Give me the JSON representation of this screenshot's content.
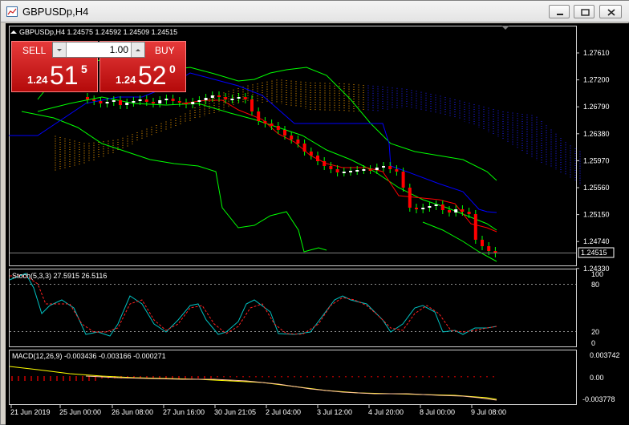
{
  "window": {
    "title": "GBPUSDp,H4"
  },
  "chart_header": "GBPUSDp,H4  1.24575 1.24592 1.24509 1.24515",
  "trade_panel": {
    "sell_label": "SELL",
    "buy_label": "BUY",
    "volume": "1.00",
    "sell_prefix": "1.24",
    "sell_big": "51",
    "sell_sup": "5",
    "buy_prefix": "1.24",
    "buy_big": "52",
    "buy_sup": "0"
  },
  "price_axis": {
    "ticks": [
      "1.27610",
      "1.27200",
      "1.26790",
      "1.26380",
      "1.25970",
      "1.25560",
      "1.25150",
      "1.24740",
      "1.24330"
    ],
    "current_price": "1.24515"
  },
  "stoch": {
    "label": "Stoch(5,3,3) 27.5915 26.5116",
    "ticks": [
      "100",
      "80",
      "20",
      "0"
    ]
  },
  "macd": {
    "label": "MACD(12,26,9) -0.003436 -0.003166 -0.000271",
    "ticks": [
      "0.003742",
      "0.00",
      "-0.003778"
    ]
  },
  "time_axis": {
    "labels": [
      "21 Jun 2019",
      "25 Jun 00:00",
      "26 Jun 08:00",
      "27 Jun 16:00",
      "30 Jun 21:05",
      "2 Jul 04:00",
      "3 Jul 12:00",
      "4 Jul 20:00",
      "8 Jul 00:00",
      "9 Jul 08:00"
    ]
  },
  "colors": {
    "bull": "#ffffff",
    "bear": "#ff0000",
    "wick": "#00ff00",
    "kijun": "#0000ff",
    "tenkan": "#ff0000",
    "bands": "#00ff00",
    "cloud_a": "#ffa500",
    "cloud_b": "#2020ff"
  }
}
